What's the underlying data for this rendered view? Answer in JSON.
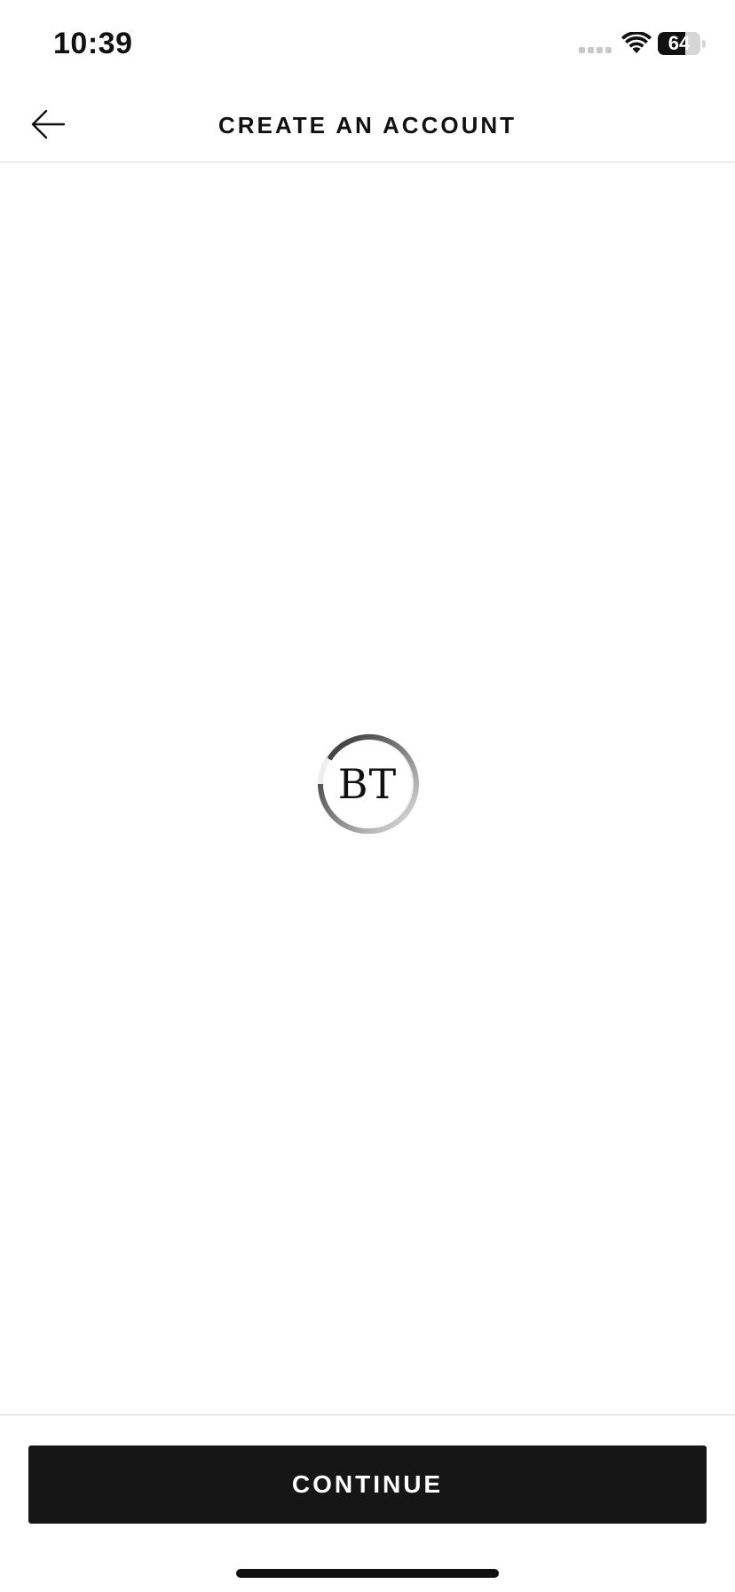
{
  "status_bar": {
    "time": "10:39",
    "battery_percent": 64,
    "battery_label": "64",
    "icons": [
      "signal-icon",
      "wifi-icon",
      "battery-icon"
    ]
  },
  "header": {
    "back_icon": "arrow-left-icon",
    "title": "CREATE AN ACCOUNT"
  },
  "loader": {
    "monogram": "BT"
  },
  "footer": {
    "continue_label": "CONTINUE"
  },
  "colors": {
    "background": "#ffffff",
    "text": "#111111",
    "button_bg": "#161616",
    "button_text": "#ffffff",
    "divider": "#d9d9d9"
  }
}
